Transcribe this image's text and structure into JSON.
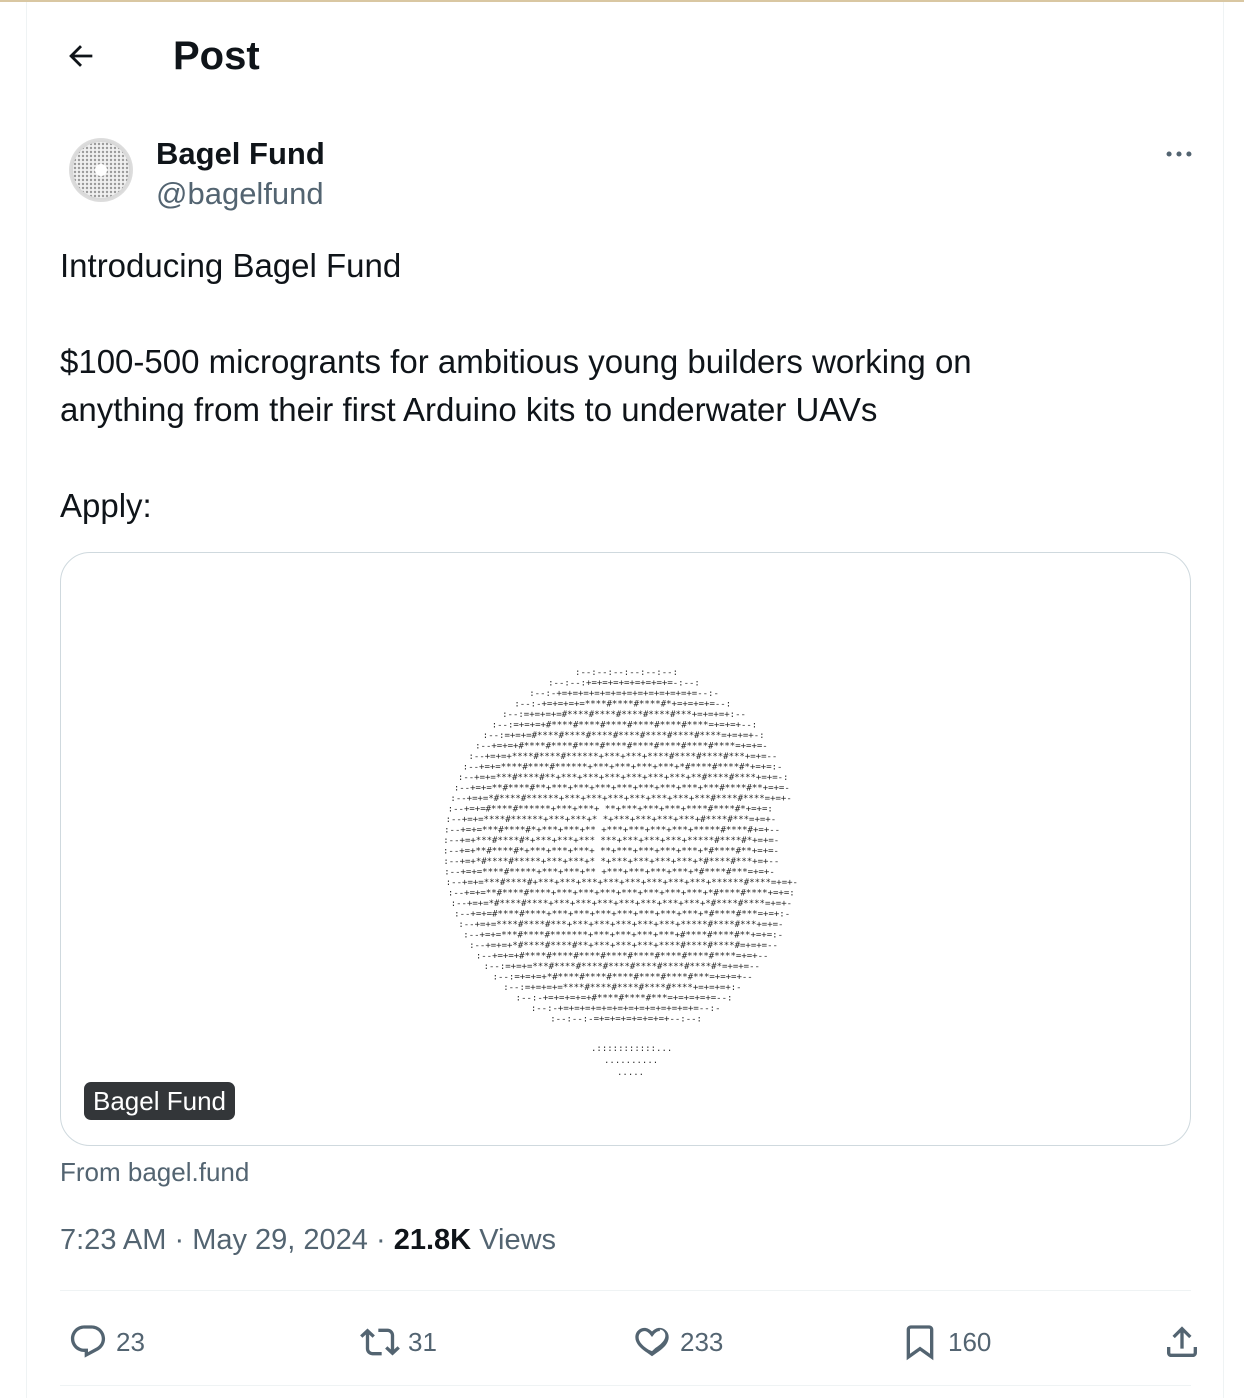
{
  "header": {
    "title": "Post"
  },
  "author": {
    "name": "Bagel Fund",
    "handle": "@bagelfund"
  },
  "tweet": {
    "line1": "Introducing Bagel Fund",
    "line2": "$100-500 microgrants for ambitious young builders working on",
    "line3": "anything from their first Arduino kits to underwater UAVs",
    "line4": "Apply:"
  },
  "card": {
    "badge": "Bagel Fund",
    "source": "From bagel.fund"
  },
  "meta": {
    "time": "7:23 AM",
    "sep1": "·",
    "date": "May 29, 2024",
    "sep2": "·",
    "views_count": "21.8K",
    "views_label": "Views"
  },
  "actions": {
    "replies": "23",
    "reposts": "31",
    "likes": "233",
    "bookmarks": "160"
  },
  "icons": [
    "back-arrow-icon",
    "more-icon",
    "reply-icon",
    "repost-icon",
    "like-icon",
    "bookmark-icon",
    "share-icon"
  ],
  "colors": {
    "text": "#0f1419",
    "secondary": "#536471",
    "border": "#cfd9de",
    "badge_bg": "#333639"
  }
}
